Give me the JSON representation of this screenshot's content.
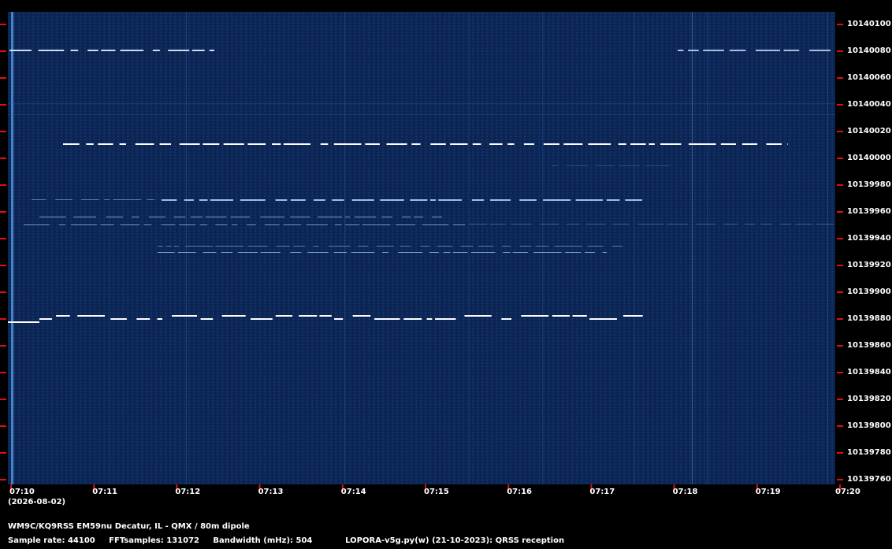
{
  "spectrogram": {
    "colors": {
      "background": "#0b2554",
      "signal": "#ffffff",
      "tick": "#e01010",
      "text": "#ffffff"
    },
    "frequency_labels": [
      "10140100",
      "10140080",
      "10140060",
      "10140040",
      "10140020",
      "10140000",
      "10139980",
      "10139960",
      "10139940",
      "10139920",
      "10139900",
      "10139880",
      "10139860",
      "10139840",
      "10139820",
      "10139800",
      "10139780",
      "10139760"
    ],
    "time_labels": [
      "07:10",
      "07:11",
      "07:12",
      "07:13",
      "07:14",
      "07:15",
      "07:16",
      "07:17",
      "07:18",
      "07:19",
      "07:20"
    ],
    "date": "(2026-08-02)"
  },
  "footer": {
    "station": "WM9C/KQ9RSS EM59nu Decatur, IL - QMX / 80m dipole",
    "sample_rate": "Sample rate: 44100",
    "fft_samples": "FFTsamples: 131072",
    "bandwidth": "Bandwidth (mHz): 504",
    "software": "LOPORA-v5g.py(w) (21-10-2023): QRSS reception"
  }
}
